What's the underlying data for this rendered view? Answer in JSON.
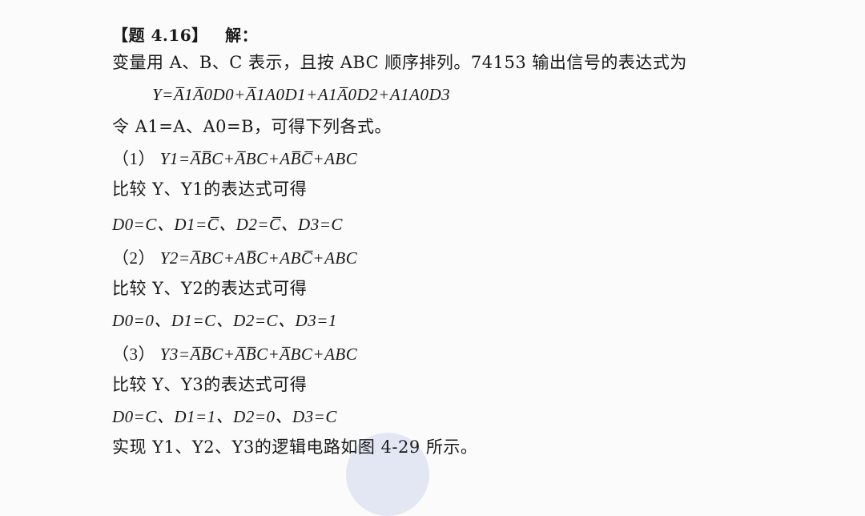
{
  "header": {
    "bracket_title": "【题 4.16】",
    "answer_label": "解："
  },
  "intro": {
    "vars": "变量用 A、B、C 表示，且按 ABC 顺序排列。74153 输出信号的表达式为",
    "main_expression": "Y=A̅1A̅0D0+A̅1A0D1+A1A̅0D2+A1A0D3",
    "substitution": "令 A1=A、A0=B，可得下列各式。"
  },
  "sections": [
    {
      "label": "（1）",
      "expression": "Y1=A̅B̅C+A̅BC+AB̅C̅+ABC",
      "compare": "比较 Y、Y1的表达式可得",
      "result": "D0=C、D1=C̅、D2=C̅、D3=C"
    },
    {
      "label": "（2）",
      "expression": "Y2=A̅BC+AB̅C+ABC̅+ABC",
      "compare": "比较 Y、Y2的表达式可得",
      "result": "D0=0、D1=C、D2=C、D3=1"
    },
    {
      "label": "（3）",
      "expression": "Y3=A̅B̅C+A̅B̅C+A̅BC+ABC",
      "compare": "比较 Y、Y3的表达式可得",
      "result": "D0=C、D1=1、D2=0、D3=C"
    }
  ],
  "footer": {
    "conclusion": "实现 Y1、Y2、Y3的逻辑电路如图 4-29 所示。"
  }
}
